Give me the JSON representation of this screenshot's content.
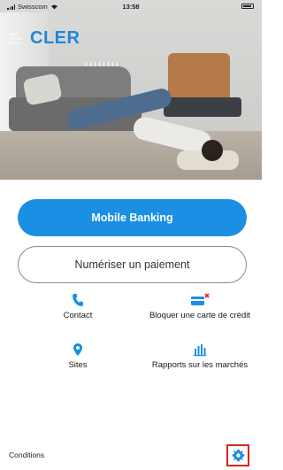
{
  "status_bar": {
    "carrier": "Swisscom",
    "time": "13:58"
  },
  "brand": {
    "small_text": "Bank Banque Banca",
    "name": "CLER",
    "color": "#1f87dc"
  },
  "hero": {
    "description": "photo"
  },
  "buttons": {
    "primary_label": "Mobile Banking",
    "secondary_label": "Numériser un paiement"
  },
  "shortcuts": {
    "contact": {
      "label": "Contact",
      "icon": "phone-icon"
    },
    "block_card": {
      "label": "Bloquer une carte de crédit",
      "icon": "credit-card-block-icon"
    },
    "sites": {
      "label": "Sites",
      "icon": "location-pin-icon"
    },
    "reports": {
      "label": "Rapports sur les marchés",
      "icon": "bar-chart-icon"
    }
  },
  "footer": {
    "conditions_label": "Conditions",
    "settings_icon": "gear-icon"
  },
  "colors": {
    "accent": "#1a8fe3",
    "highlight": "#d9261c"
  }
}
